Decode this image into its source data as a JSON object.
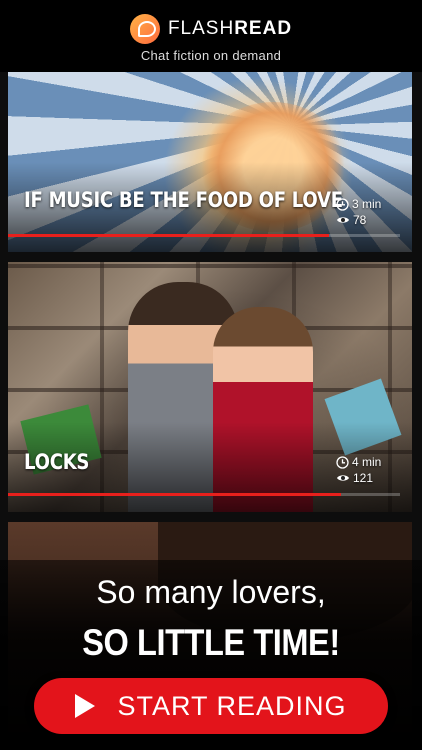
{
  "header": {
    "brand_light": "FLASH",
    "brand_bold": "READ",
    "tagline": "Chat fiction on demand"
  },
  "stories": [
    {
      "title": "IF MUSIC BE THE FOOD OF LOVE",
      "duration": "3 min",
      "views": "78",
      "progress": 0.82
    },
    {
      "title": "LOCKS",
      "duration": "4 min",
      "views": "121",
      "progress": 0.85
    }
  ],
  "promo": {
    "line1": "So many lovers,",
    "line2": "SO LITTLE TIME!",
    "cta_label": "START READING"
  },
  "colors": {
    "accent": "#e3141b",
    "progress": "#e8201c",
    "logo_gradient": "#ff6a3d"
  }
}
